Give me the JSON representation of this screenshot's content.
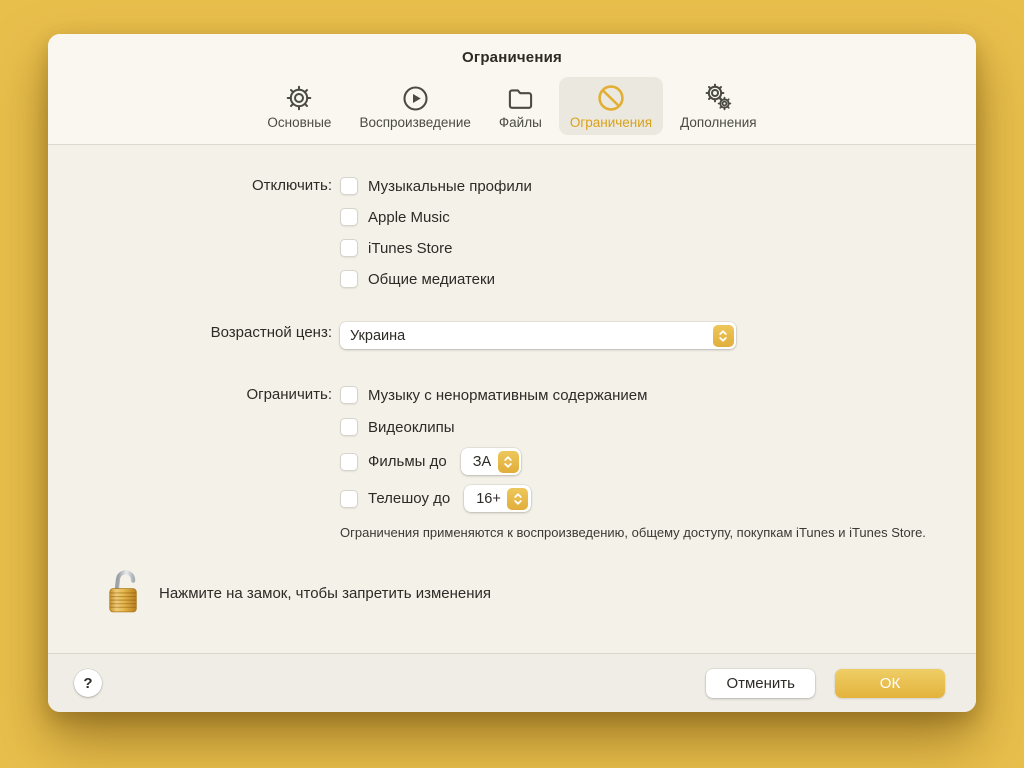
{
  "accent_color": "#E3B33C",
  "selected_tab_color": "#D9A21A",
  "window": {
    "title": "Ограничения"
  },
  "toolbar": {
    "tabs": [
      {
        "label": "Основные",
        "icon": "gear-icon",
        "selected": false
      },
      {
        "label": "Воспроизведение",
        "icon": "play-icon",
        "selected": false
      },
      {
        "label": "Файлы",
        "icon": "folder-icon",
        "selected": false
      },
      {
        "label": "Ограничения",
        "icon": "prohibition-icon",
        "selected": true
      },
      {
        "label": "Дополнения",
        "icon": "gears-icon",
        "selected": false
      }
    ]
  },
  "form": {
    "disable": {
      "label": "Отключить:",
      "options": [
        "Музыкальные профили",
        "Apple Music",
        "iTunes Store",
        "Общие медиатеки"
      ],
      "checked": [
        false,
        false,
        false,
        false
      ]
    },
    "age_rating": {
      "label": "Возрастной ценз:",
      "value": "Украина"
    },
    "restrict": {
      "label": "Ограничить:",
      "options": [
        {
          "label": "Музыку с ненормативным содержанием",
          "checked": false
        },
        {
          "label": "Видеоклипы",
          "checked": false
        },
        {
          "label": "Фильмы до",
          "checked": false,
          "value": "ЗА"
        },
        {
          "label": "Телешоу до",
          "checked": false,
          "value": "16+"
        }
      ]
    },
    "note": "Ограничения применяются к воспроизведению, общему доступу, покупкам iTunes и iTunes Store."
  },
  "lock": {
    "message": "Нажмите на замок, чтобы запретить изменения"
  },
  "footer": {
    "help_label": "?",
    "cancel_label": "Отменить",
    "ok_label": "ОК"
  }
}
